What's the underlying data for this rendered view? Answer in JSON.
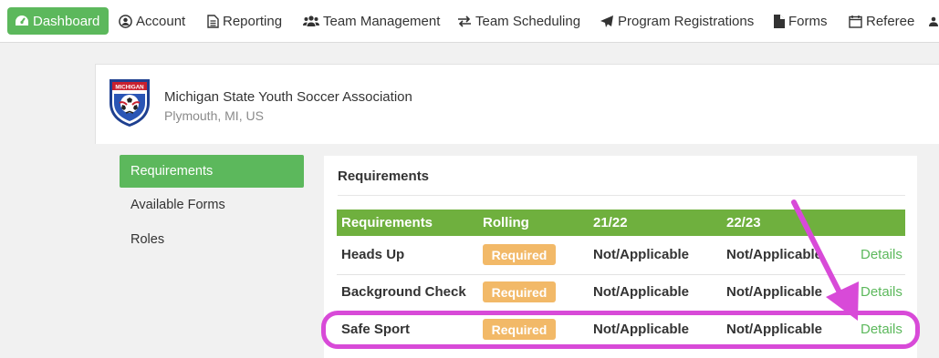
{
  "nav": {
    "items": [
      {
        "label": "Dashboard",
        "icon": "dashboard-icon",
        "active": true
      },
      {
        "label": "Account",
        "icon": "user-circle-icon"
      },
      {
        "label": "Reporting",
        "icon": "document-icon"
      },
      {
        "label": "Team Management",
        "icon": "users-icon"
      },
      {
        "label": "Team Scheduling",
        "icon": "exchange-arrows-icon"
      },
      {
        "label": "Program Registrations",
        "icon": "paper-plane-icon"
      },
      {
        "label": "Forms",
        "icon": "file-icon"
      },
      {
        "label": "Referee",
        "icon": "calendar-icon"
      }
    ]
  },
  "org": {
    "logo_text": "MICHIGAN",
    "name": "Michigan State Youth Soccer Association",
    "location": "Plymouth, MI, US"
  },
  "sidebar": {
    "items": [
      {
        "label": "Requirements",
        "active": true
      },
      {
        "label": "Available Forms"
      },
      {
        "label": "Roles"
      }
    ]
  },
  "requirements": {
    "title": "Requirements",
    "columns": [
      "Requirements",
      "Rolling",
      "21/22",
      "22/23"
    ],
    "rows": [
      {
        "name": "Heads Up",
        "rolling": "Required",
        "s2122": "Not/Applicable",
        "s2223": "Not/Applicable",
        "action": "Details"
      },
      {
        "name": "Background Check",
        "rolling": "Required",
        "s2122": "Not/Applicable",
        "s2223": "Not/Applicable",
        "action": "Details"
      },
      {
        "name": "Safe Sport",
        "rolling": "Required",
        "s2122": "Not/Applicable",
        "s2223": "Not/Applicable",
        "action": "Details"
      }
    ]
  },
  "colors": {
    "accent_green": "#5cb85c",
    "header_green": "#6fb03e",
    "badge_orange": "#f0ad4e",
    "annotation_magenta": "#d84ad8"
  }
}
